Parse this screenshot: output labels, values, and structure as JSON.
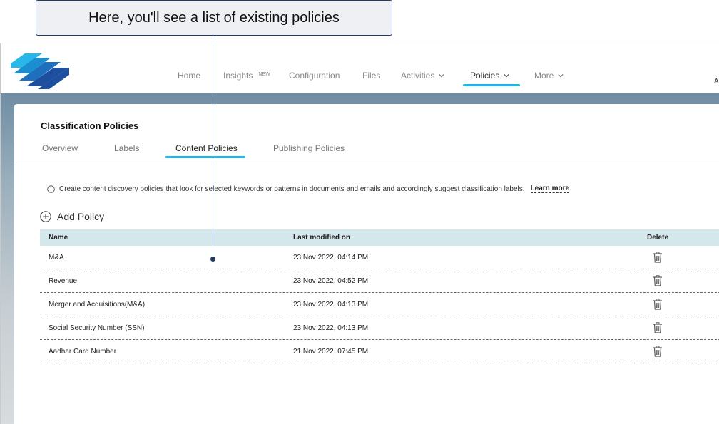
{
  "callout": {
    "text": "Here, you'll see a list of existing policies"
  },
  "nav": {
    "items": [
      {
        "label": "Home"
      },
      {
        "label": "Insights",
        "badge": "NEW"
      },
      {
        "label": "Configuration"
      },
      {
        "label": "Files"
      },
      {
        "label": "Activities"
      },
      {
        "label": "Policies"
      },
      {
        "label": "More"
      }
    ],
    "active": "Policies",
    "accent": "#1eb6e6",
    "cut_text": "A"
  },
  "page": {
    "title": "Classification Policies",
    "tabs": [
      {
        "label": "Overview"
      },
      {
        "label": "Labels"
      },
      {
        "label": "Content Policies"
      },
      {
        "label": "Publishing Policies"
      }
    ],
    "active_tab": "Content Policies"
  },
  "info": {
    "text": "Create content discovery policies that look for selected keywords or patterns in documents and emails and accordingly suggest classification labels.",
    "link": "Learn more"
  },
  "add_policy_label": "Add Policy",
  "table": {
    "headers": {
      "name": "Name",
      "modified": "Last modified on",
      "delete": "Delete"
    },
    "header_bg": "#d4e7ea",
    "rows": [
      {
        "name": "M&A",
        "modified": "23 Nov 2022, 04:14 PM"
      },
      {
        "name": "Revenue",
        "modified": "23 Nov 2022, 04:52 PM"
      },
      {
        "name": "Merger and Acquisitions(M&A)",
        "modified": "23 Nov 2022, 04:13 PM"
      },
      {
        "name": "Social Security Number (SSN)",
        "modified": "23 Nov 2022, 04:13 PM"
      },
      {
        "name": "Aadhar Card Number",
        "modified": "21 Nov 2022, 07:45 PM"
      }
    ]
  }
}
